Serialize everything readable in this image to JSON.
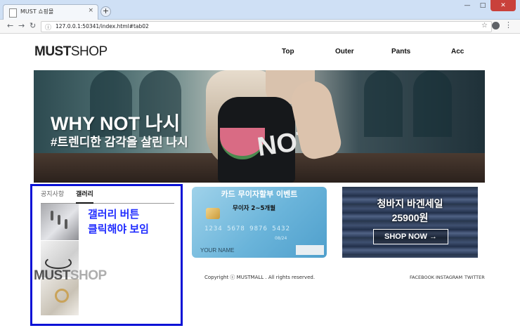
{
  "browser": {
    "tab_title": "MUST 쇼핑몰",
    "tab_close": "×",
    "new_tab": "+",
    "url": "127.0.0.1:50341/index.html#tab02",
    "controls": {
      "minimize": "—",
      "maximize": "□",
      "close": "✕"
    }
  },
  "header": {
    "logo_bold": "MUST",
    "logo_thin": "SHOP",
    "menu": [
      "Top",
      "Outer",
      "Pants",
      "Acc"
    ]
  },
  "banner": {
    "headline": "WHY NOT 나시",
    "subhead": "#트렌디한 감각을 살린 나시",
    "shirt_print": "NOT?"
  },
  "gallery_panel": {
    "tabs": [
      "공지사항",
      "갤러리"
    ],
    "active_tab": "갤러리",
    "annotation_line1": "갤러리 버튼",
    "annotation_line2": "클릭해야 보임",
    "overlay_logo_bold": "MUST",
    "overlay_logo_thin": "SHOP"
  },
  "card_event": {
    "title": "카드 무이자할부 이벤트",
    "subtitle": "무이자 2~5개월",
    "number": "1234 5678 9876 5432",
    "date": "08/24",
    "name": "YOUR NAME"
  },
  "jeans_sale": {
    "title": "청바지 바겐세일",
    "price": "25900원",
    "button": "SHOP NOW →"
  },
  "footer": {
    "copyright": "Copyright ⓒ MUSTMALL . All rights reserved.",
    "social": [
      "FACEBOOK",
      "INSTAGRAM",
      "TWITTER"
    ]
  },
  "colors": {
    "annotation_blue": "#1f2bff",
    "highlight_box": "#0a12d6"
  }
}
